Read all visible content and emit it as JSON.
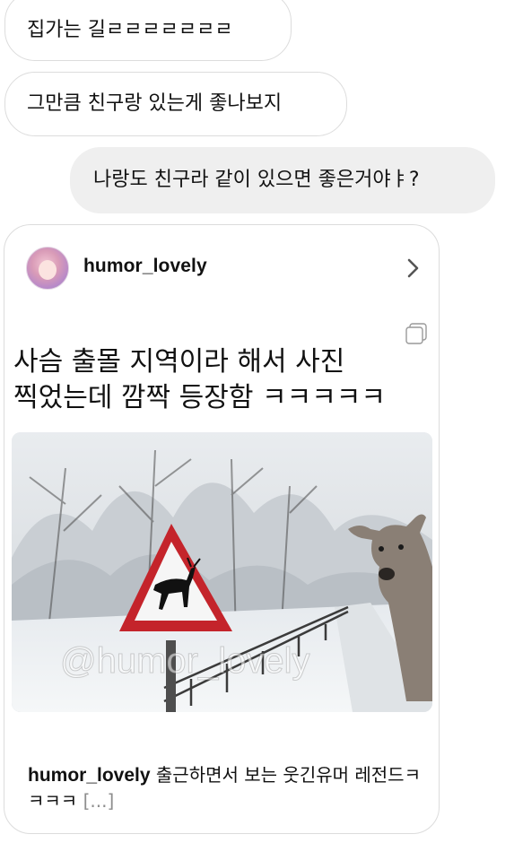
{
  "messages": [
    {
      "side": "received",
      "text": "집가는 길ㄹㄹㄹㄹㄹㄹㄹ"
    },
    {
      "side": "received",
      "text": "그만큼 친구랑 있는게 좋나보지"
    },
    {
      "side": "sent",
      "text": "나랑도 친구라 같이 있으면 좋은거야ㅑ?"
    }
  ],
  "shared_post": {
    "username": "humor_lovely",
    "headline_line1": "사슴 출몰 지역이라 해서 사진",
    "headline_line2": "찍었는데 깜짝 등장함 ㅋㅋㅋㅋㅋ",
    "image_watermark": "@humor_lovely",
    "caption_username": "humor_lovely",
    "caption_text": " 출근하면서 보는 웃긴유머 레전드ㅋㅋㅋㅋ ",
    "caption_more": "[...]",
    "icons": {
      "chevron": "chevron-right-icon",
      "multi_image": "multi-image-icon"
    }
  }
}
